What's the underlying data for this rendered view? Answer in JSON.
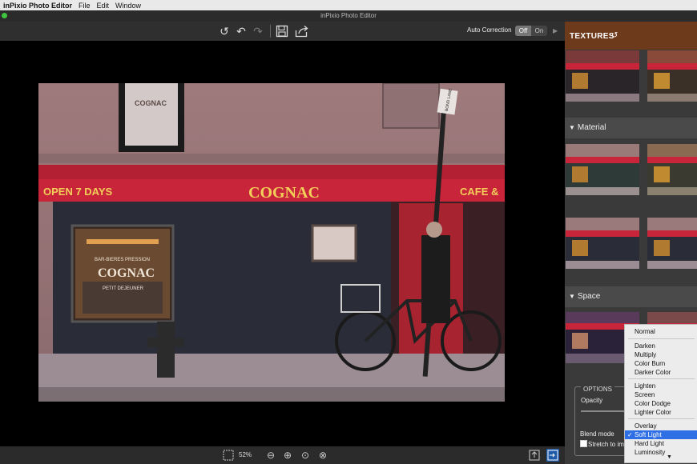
{
  "menubar": {
    "app": "inPixio Photo Editor",
    "items": [
      "File",
      "Edit",
      "Window"
    ]
  },
  "window": {
    "title": "inPixio Photo Editor"
  },
  "toolbar": {
    "auto_correction_label": "Auto Correction",
    "toggle_off": "Off",
    "toggle_on": "On"
  },
  "photo": {
    "awning_left": "OPEN 7 DAYS",
    "awning_center": "COGNAC",
    "awning_right": "CAFE &",
    "window_sign": "COGNAC",
    "window_top": "BAR-BIERES PRESSION",
    "window_brand": "COGNAC",
    "window_bottom": "PETIT DEJEUNER",
    "street_sign": "BOND LANE"
  },
  "bottombar": {
    "zoom": "52%"
  },
  "panel": {
    "title": "TEXTURES",
    "sections": [
      {
        "name": "Material"
      },
      {
        "name": "Space"
      }
    ],
    "options": {
      "title": "OPTIONS",
      "opacity_label": "Opacity",
      "blend_label": "Blend mode",
      "stretch_label": "Stretch to im"
    }
  },
  "blend_dropdown": {
    "items": [
      "Normal",
      "Darken",
      "Multiply",
      "Color Burn",
      "Darker Color",
      "Lighten",
      "Screen",
      "Color Dodge",
      "Lighter Color",
      "Overlay",
      "Soft Light",
      "Hard Light",
      "Luminosity"
    ],
    "selected": "Soft Light"
  },
  "colors": {
    "awning": "#c8243a",
    "awning_text": "#f3cf5a",
    "selection": "#2f6fe6",
    "panel_header": "#6e3a1c"
  }
}
